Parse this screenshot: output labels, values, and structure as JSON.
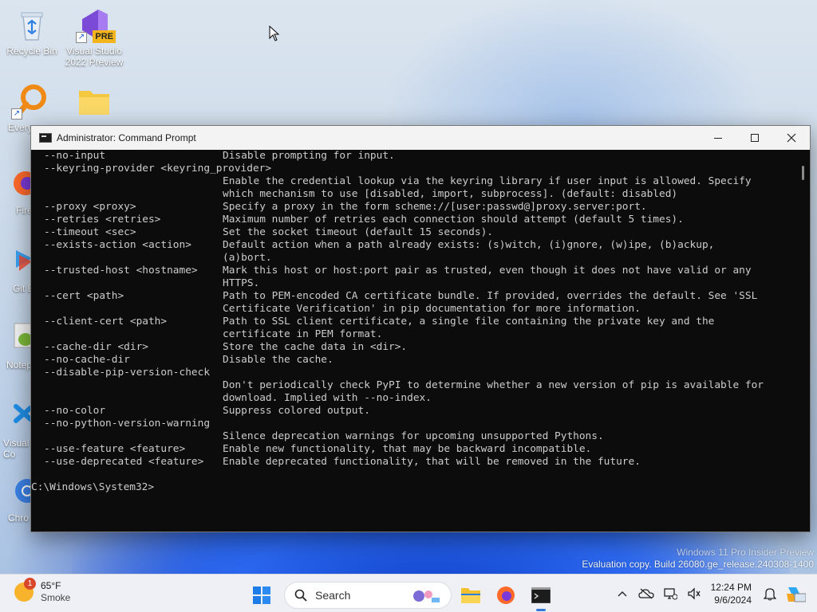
{
  "desktop": {
    "icons": [
      {
        "label": "Recycle Bin",
        "icon": "recycle-bin-icon"
      },
      {
        "label": "Visual Studio 2022 Preview",
        "badge": "PRE",
        "icon": "visual-studio-icon"
      },
      {
        "label": "Every",
        "icon": "everything-search-icon"
      },
      {
        "label": "",
        "icon": "folder-icon"
      },
      {
        "label": "Fire",
        "icon": "firefox-icon"
      },
      {
        "label": "Git B",
        "icon": "git-bash-icon"
      },
      {
        "label": "Notep",
        "icon": "notepad-plus-plus-icon"
      },
      {
        "label": "Visual Co",
        "icon": "vscode-icon"
      },
      {
        "label": "Chro",
        "icon": "chrome-icon"
      }
    ],
    "watermark": {
      "line1": "Windows 11 Pro Insider Preview",
      "line2": "Evaluation copy. Build 26080.ge_release.240308-1400"
    }
  },
  "window": {
    "title": "Administrator: Command Prompt",
    "controls": {
      "minimize": "minimize",
      "maximize": "maximize",
      "close": "close"
    }
  },
  "console": {
    "rows": [
      {
        "opt": "--no-input",
        "desc": "Disable prompting for input."
      },
      {
        "opt": "--keyring-provider <keyring_provider>",
        "desc": ""
      },
      {
        "opt": "",
        "desc": "Enable the credential lookup via the keyring library if user input is allowed. Specify"
      },
      {
        "opt": "",
        "desc": "which mechanism to use [disabled, import, subprocess]. (default: disabled)"
      },
      {
        "opt": "--proxy <proxy>",
        "desc": "Specify a proxy in the form scheme://[user:passwd@]proxy.server:port."
      },
      {
        "opt": "--retries <retries>",
        "desc": "Maximum number of retries each connection should attempt (default 5 times)."
      },
      {
        "opt": "--timeout <sec>",
        "desc": "Set the socket timeout (default 15 seconds)."
      },
      {
        "opt": "--exists-action <action>",
        "desc": "Default action when a path already exists: (s)witch, (i)gnore, (w)ipe, (b)ackup,"
      },
      {
        "opt": "",
        "desc": "(a)bort."
      },
      {
        "opt": "--trusted-host <hostname>",
        "desc": "Mark this host or host:port pair as trusted, even though it does not have valid or any"
      },
      {
        "opt": "",
        "desc": "HTTPS."
      },
      {
        "opt": "--cert <path>",
        "desc": "Path to PEM-encoded CA certificate bundle. If provided, overrides the default. See 'SSL"
      },
      {
        "opt": "",
        "desc": "Certificate Verification' in pip documentation for more information."
      },
      {
        "opt": "--client-cert <path>",
        "desc": "Path to SSL client certificate, a single file containing the private key and the"
      },
      {
        "opt": "",
        "desc": "certificate in PEM format."
      },
      {
        "opt": "--cache-dir <dir>",
        "desc": "Store the cache data in <dir>."
      },
      {
        "opt": "--no-cache-dir",
        "desc": "Disable the cache."
      },
      {
        "opt": "--disable-pip-version-check",
        "desc": ""
      },
      {
        "opt": "",
        "desc": "Don't periodically check PyPI to determine whether a new version of pip is available for"
      },
      {
        "opt": "",
        "desc": "download. Implied with --no-index."
      },
      {
        "opt": "--no-color",
        "desc": "Suppress colored output."
      },
      {
        "opt": "--no-python-version-warning",
        "desc": ""
      },
      {
        "opt": "",
        "desc": "Silence deprecation warnings for upcoming unsupported Pythons."
      },
      {
        "opt": "--use-feature <feature>",
        "desc": "Enable new functionality, that may be backward incompatible."
      },
      {
        "opt": "--use-deprecated <feature>",
        "desc": "Enable deprecated functionality, that will be removed in the future."
      }
    ],
    "prompt": "C:\\Windows\\System32>"
  },
  "taskbar": {
    "weather": {
      "temp": "65°F",
      "condition": "Smoke",
      "badge": "1"
    },
    "search_label": "Search",
    "apps": [
      {
        "name": "file-explorer",
        "icon": "folder-icon"
      },
      {
        "name": "firefox",
        "icon": "firefox-icon"
      },
      {
        "name": "command-prompt",
        "icon": "terminal-icon",
        "active": true
      }
    ],
    "clock": {
      "time": "12:24 PM",
      "date": "9/6/2024"
    }
  },
  "colors": {
    "console_bg": "#0c0c0c",
    "console_fg": "#cccccc",
    "titlebar_bg": "#f3f3f3",
    "taskbar_bg": "#eef0f5",
    "accent": "#3578d8"
  }
}
